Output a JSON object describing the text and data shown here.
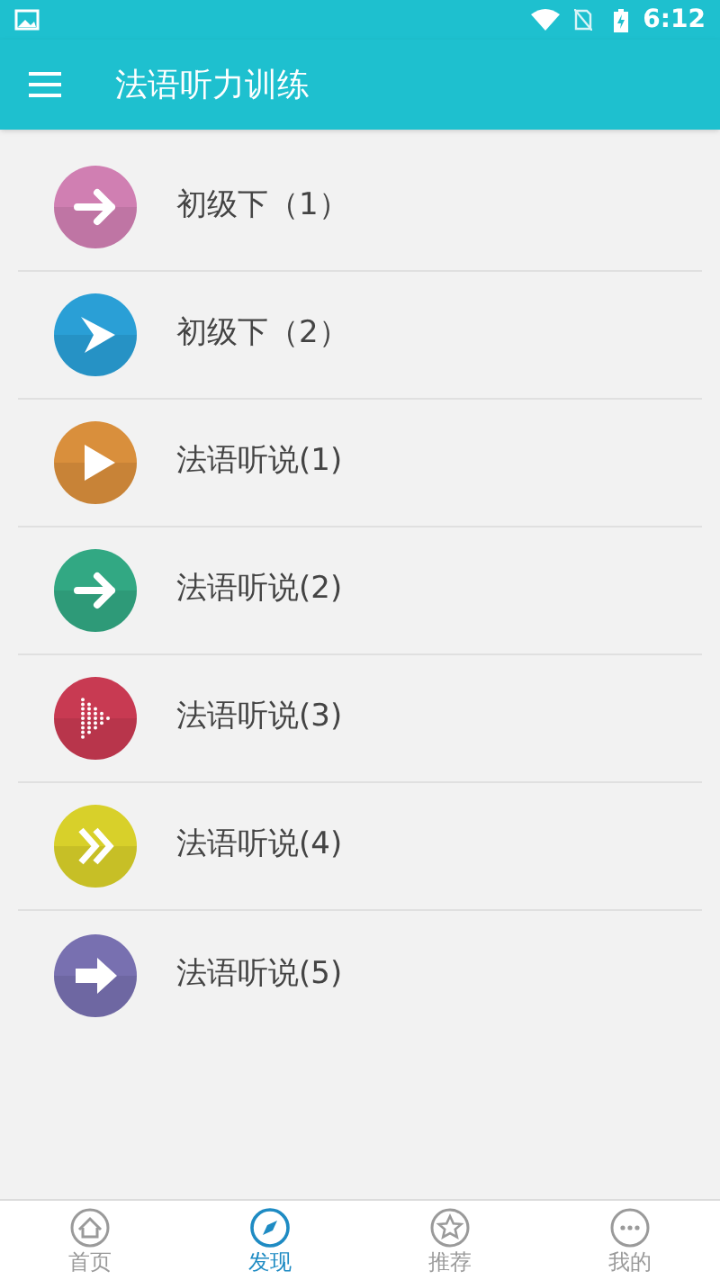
{
  "status_bar": {
    "time": "6:12"
  },
  "app_bar": {
    "title": "法语听力训练"
  },
  "items": [
    {
      "label": "初级下（1）",
      "kind": "arrow",
      "color": "#d07fb2"
    },
    {
      "label": "初级下（2）",
      "kind": "chevron",
      "color": "#2a9fd6"
    },
    {
      "label": "法语听说(1)",
      "kind": "triangle",
      "color": "#d98f3c"
    },
    {
      "label": "法语听说(2)",
      "kind": "arrow",
      "color": "#32a883"
    },
    {
      "label": "法语听说(3)",
      "kind": "dots",
      "color": "#c83a52"
    },
    {
      "label": "法语听说(4)",
      "kind": "double",
      "color": "#d8d02a"
    },
    {
      "label": "法语听说(5)",
      "kind": "fat",
      "color": "#7870b0"
    }
  ],
  "nav": [
    {
      "label": "首页",
      "kind": "home",
      "selected": false
    },
    {
      "label": "发现",
      "kind": "compass",
      "selected": true
    },
    {
      "label": "推荐",
      "kind": "star",
      "selected": false
    },
    {
      "label": "我的",
      "kind": "more",
      "selected": false
    }
  ]
}
